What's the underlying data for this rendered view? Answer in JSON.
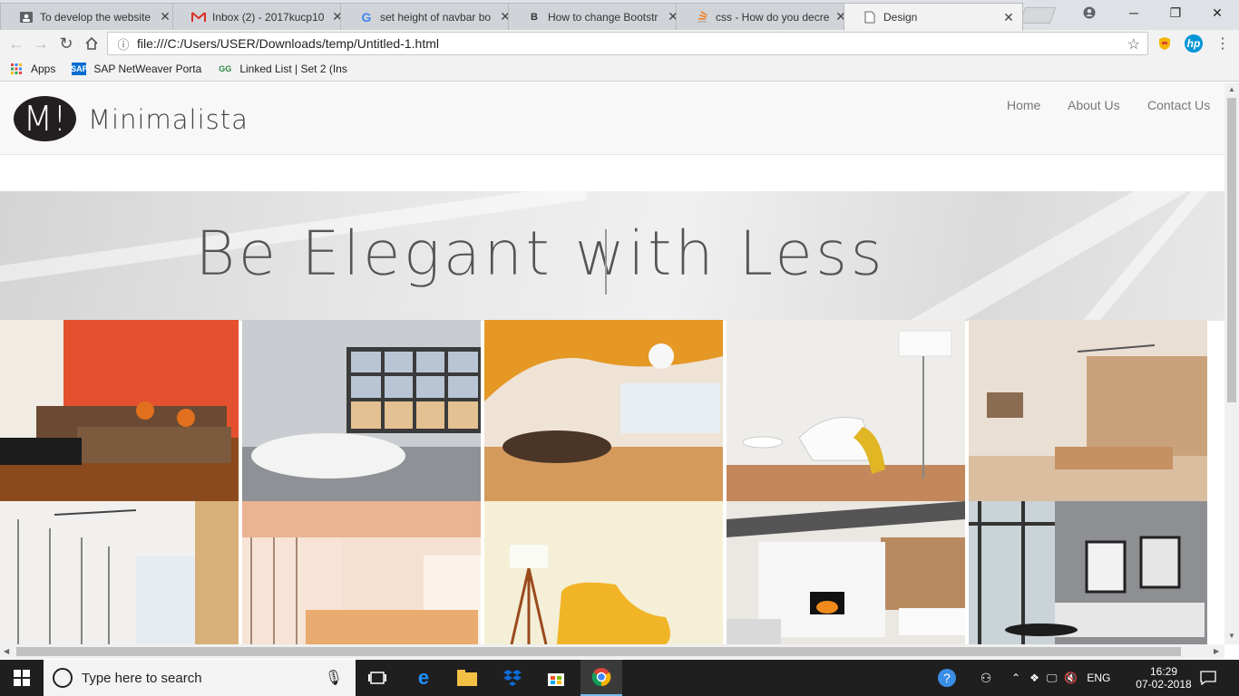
{
  "tabs": [
    {
      "title": "To develop the website",
      "icon": "user-card-icon"
    },
    {
      "title": "Inbox (2) - 2017kucp10",
      "icon": "gmail-icon"
    },
    {
      "title": "set height of navbar bo",
      "icon": "google-icon"
    },
    {
      "title": "How to change Bootstr",
      "icon": "bootstrap-icon"
    },
    {
      "title": "css - How do you decre",
      "icon": "stackoverflow-icon"
    },
    {
      "title": "Design",
      "icon": "page-icon"
    }
  ],
  "address": {
    "url": "file:///C:/Users/USER/Downloads/temp/Untitled-1.html"
  },
  "bookmarks": [
    {
      "label": "Apps"
    },
    {
      "label": "SAP NetWeaver Porta"
    },
    {
      "label": "Linked List | Set 2 (Ins"
    }
  ],
  "site": {
    "logo_letter": "M!",
    "brand": "Minimalista",
    "nav": [
      "Home",
      "About Us",
      "Contact Us"
    ],
    "tagline": "Be Elegant with Less",
    "gallery": [
      {
        "name": "living-room-orange-wall"
      },
      {
        "name": "white-bathroom"
      },
      {
        "name": "orange-ceiling-lounge"
      },
      {
        "name": "white-chair-lamp"
      },
      {
        "name": "wood-panel-office"
      },
      {
        "name": "glass-office-corridor"
      },
      {
        "name": "open-office-desks"
      },
      {
        "name": "yellow-armchair-lamp"
      },
      {
        "name": "fireplace-living-room"
      },
      {
        "name": "grey-sofa-living-room"
      }
    ]
  },
  "taskbar": {
    "search_placeholder": "Type here to search",
    "language": "ENG",
    "time": "16:29",
    "date": "07-02-2018"
  },
  "colors": {
    "chrome_bg": "#dee1e6",
    "navbar_bg": "#f8f8f8",
    "taskbar_bg": "#1f1f1f"
  }
}
